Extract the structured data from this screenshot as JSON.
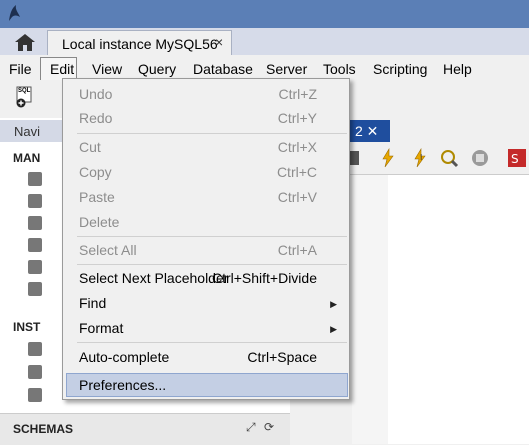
{
  "window": {
    "tab_title": "Local instance MySQL56",
    "tab_close": "×"
  },
  "menubar": [
    "File",
    "Edit",
    "View",
    "Query",
    "Database",
    "Server",
    "Tools",
    "Scripting",
    "Help"
  ],
  "toolbar": {
    "sql_icon_label": "SQL"
  },
  "navigator": {
    "header": "Navi",
    "management_title": "MAN",
    "instance_title": "INST",
    "schemas_title": "SCHEMAS"
  },
  "editor": {
    "tab_label": "2 ✕"
  },
  "edit_menu": {
    "items": [
      {
        "label": "Undo",
        "shortcut": "Ctrl+Z",
        "enabled": false
      },
      {
        "label": "Redo",
        "shortcut": "Ctrl+Y",
        "enabled": false
      },
      {
        "label": "Cut",
        "shortcut": "Ctrl+X",
        "enabled": false
      },
      {
        "label": "Copy",
        "shortcut": "Ctrl+C",
        "enabled": false
      },
      {
        "label": "Paste",
        "shortcut": "Ctrl+V",
        "enabled": false
      },
      {
        "label": "Delete",
        "shortcut": "",
        "enabled": false
      },
      {
        "label": "Select All",
        "shortcut": "Ctrl+A",
        "enabled": false
      },
      {
        "label": "Select Next Placeholder",
        "shortcut": "Ctrl+Shift+Divide",
        "enabled": true
      },
      {
        "label": "Find",
        "shortcut": "",
        "enabled": true,
        "submenu": true
      },
      {
        "label": "Format",
        "shortcut": "",
        "enabled": true,
        "submenu": true
      },
      {
        "label": "Auto-complete",
        "shortcut": "Ctrl+Space",
        "enabled": true
      },
      {
        "label": "Preferences...",
        "shortcut": "",
        "enabled": true,
        "highlighted": true
      }
    ]
  },
  "colors": {
    "titlebar": "#5b7fb6",
    "editor_tab": "#1f4e9e",
    "highlight": "#c4cfe4"
  }
}
